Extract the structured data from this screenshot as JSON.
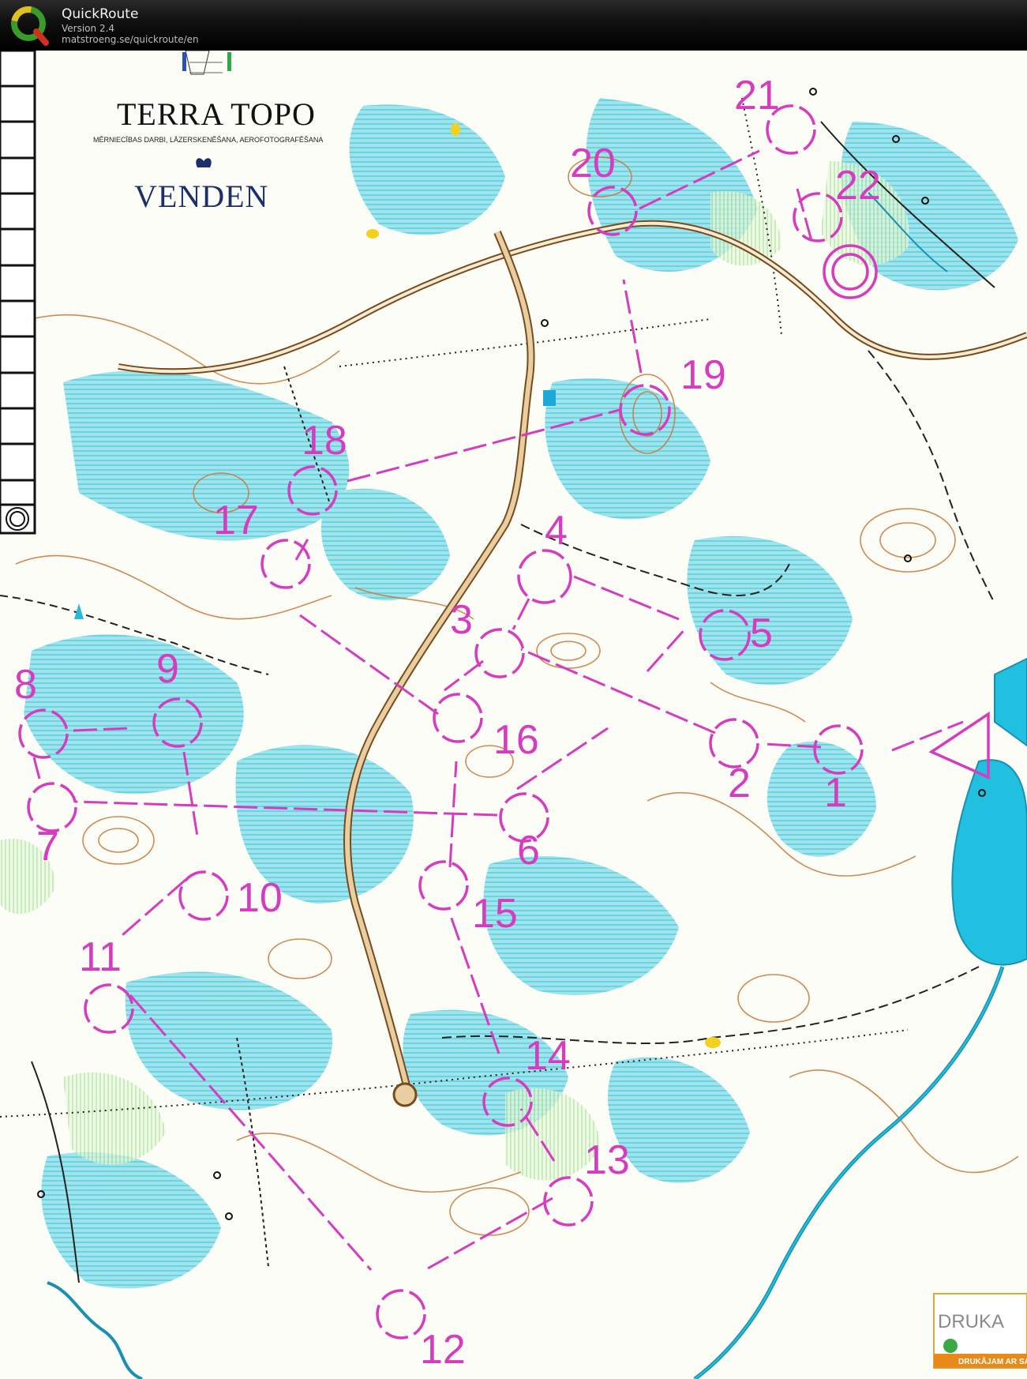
{
  "app": {
    "title": "QuickRoute",
    "version": "Version 2.4",
    "url": "matstroeng.se/quickroute/en"
  },
  "sponsors": {
    "terra_topo": "TERRA TOPO",
    "terra_topo_sub": "MĒRNIECĪBAS DARBI, LĀZERSKENĒŠANA, AEROFOTOGRAFĒŠANA",
    "venden": "VENDEN",
    "druka": "DRUKA",
    "druka_sub": "DRUKĀJAM AR SAULI"
  },
  "colors": {
    "course": "#d63cc0",
    "vegetation": "#3ec6d8",
    "contour": "#c8783a",
    "road": "#9a6a3a",
    "water": "#20b8d8"
  },
  "controls": [
    {
      "label": "1"
    },
    {
      "label": "2"
    },
    {
      "label": "3"
    },
    {
      "label": "4"
    },
    {
      "label": "5"
    },
    {
      "label": "6"
    },
    {
      "label": "7"
    },
    {
      "label": "8"
    },
    {
      "label": "9"
    },
    {
      "label": "10"
    },
    {
      "label": "11"
    },
    {
      "label": "12"
    },
    {
      "label": "13"
    },
    {
      "label": "14"
    },
    {
      "label": "15"
    },
    {
      "label": "16"
    },
    {
      "label": "17"
    },
    {
      "label": "18"
    },
    {
      "label": "19"
    },
    {
      "label": "20"
    },
    {
      "label": "21"
    },
    {
      "label": "22"
    }
  ]
}
